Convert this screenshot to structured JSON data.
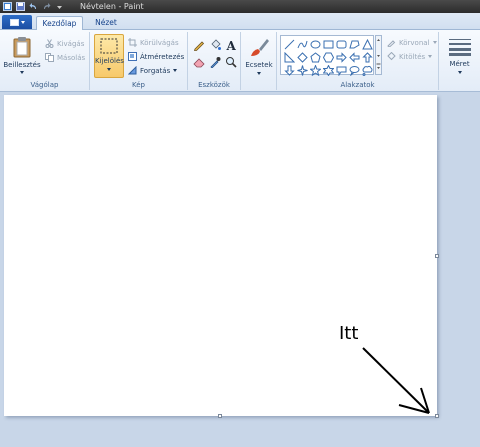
{
  "window": {
    "title": "Névtelen - Paint"
  },
  "tabs": [
    {
      "label": "Kezdőlap",
      "active": true
    },
    {
      "label": "Nézet",
      "active": false
    }
  ],
  "ribbon": {
    "clipboard": {
      "label": "Vágólap",
      "paste": "Beillesztés",
      "cut": "Kivágás",
      "copy": "Másolás"
    },
    "image": {
      "label": "Kép",
      "select": "Kijelölés",
      "crop": "Körülvágás",
      "resize": "Átméretezés",
      "rotate": "Forgatás"
    },
    "tools": {
      "label": "Eszközök",
      "items": [
        "pencil-icon",
        "fill-icon",
        "text-icon",
        "eraser-icon",
        "color-picker-icon",
        "magnifier-icon"
      ]
    },
    "brushes": {
      "label": "Ecsetek"
    },
    "shapes": {
      "label": "Alakzatok",
      "outline": "Körvonal",
      "fill": "Kitöltés"
    },
    "size": {
      "label": "Méret"
    }
  },
  "canvas": {
    "annotation": "Itt"
  },
  "colors": {
    "accent": "#1b4ea3",
    "selected": "#f7c96b",
    "workspace": "#c8d6e8"
  }
}
